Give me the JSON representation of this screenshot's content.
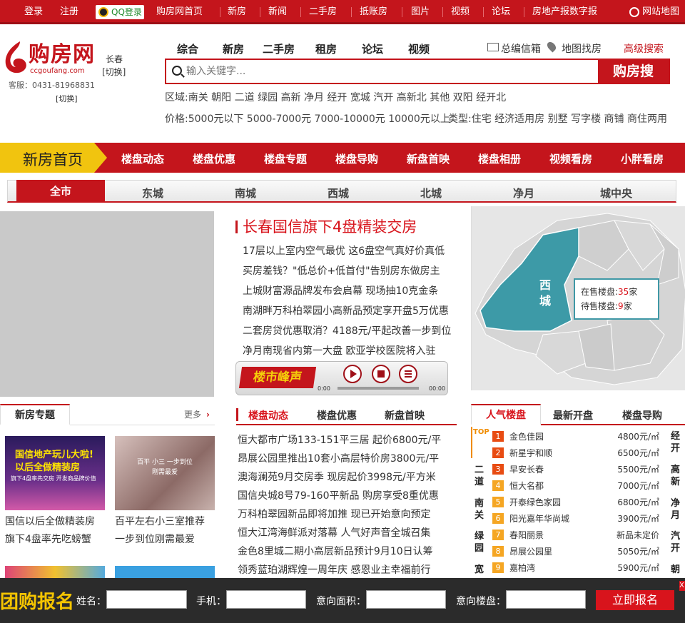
{
  "topbar": {
    "login": "登录",
    "register": "注册",
    "qq_login": "QQ登录",
    "links": [
      "购房网首页",
      "新房",
      "新闻",
      "二手房",
      "抵账房",
      "图片",
      "视频",
      "论坛",
      "房地产报数字报"
    ],
    "sitemap": "网站地图"
  },
  "header": {
    "logo_text": "购房网",
    "logo_domain": "ccgoufang.com",
    "city": "长春",
    "city_switch": "[切换]",
    "hotline": "客服：0431-81968831",
    "switch2": "[切换]",
    "search_tabs": [
      "综合",
      "新房",
      "二手房",
      "租房",
      "论坛",
      "视频"
    ],
    "mailbox": "总编信箱",
    "map_search": "地图找房",
    "advanced_search": "高级搜索",
    "search_placeholder": "输入关键字...",
    "search_button": "购房搜",
    "area_filter": "区域:南关 朝阳 二道 绿园 高新 净月 经开 宽城 汽开 高新北 其他 双阳 经开北",
    "price_filter": "价格:5000元以下 5000-7000元 7000-10000元 10000元以上",
    "type_filter": "类型:住宅 经济适用房 别墅 写字楼 商铺 商住两用"
  },
  "section_nav": {
    "home": "新房首页",
    "items": [
      "楼盘动态",
      "楼盘优惠",
      "楼盘专题",
      "楼盘导购",
      "新盘首映",
      "楼盘相册",
      "视频看房",
      "小胖看房"
    ]
  },
  "districts": [
    "全市",
    "东城",
    "南城",
    "西城",
    "北城",
    "净月",
    "城中央"
  ],
  "headline": {
    "title": "长春国信旗下4盘精装交房",
    "items": [
      "17层以上室内空气最优 这6盘空气真好价真低",
      "买房差钱？\"低总价+低首付\"告别房东做房主",
      "上城财富源品牌发布会启幕 现场抽10克金条",
      "南湖畔万科柏翠园小高新品预定享开盘5万优惠",
      "二套房贷优惠取消？4188元/平起改善一步到位",
      "净月南现省内第一大盘 欧亚学校医院将入驻"
    ]
  },
  "player": {
    "brand": "楼市峰声",
    "time_start": "0:00",
    "time_end": "00:00"
  },
  "map": {
    "area": "西城",
    "on_sale_label": "在售楼盘:",
    "on_sale_count": "35",
    "on_sale_unit": "家",
    "pending_label": "待售楼盘:",
    "pending_count": "9",
    "pending_unit": "家",
    "base_color": "#e6e6e6",
    "highlight_color": "#3d9aa7"
  },
  "zhuanti": {
    "title": "新房专题",
    "more": "更多",
    "thumb1_line1": "国信地产玩儿大啦!",
    "thumb1_line2": "以后全做精装房",
    "thumb1_small": "旗下4盘率先交房 开发商品牌价值",
    "thumb2_text": "百平 小三 一步到位 刚需最爱",
    "captions": [
      "国信以后全做精装房",
      "旗下4盘率先吃螃蟹",
      "百平左右小三室推荐",
      "一步到位刚需最爱"
    ]
  },
  "dynamics": {
    "tabs": [
      "楼盘动态",
      "楼盘优惠",
      "新盘首映"
    ],
    "items": [
      "恒大都市广场133-151平三居 起价6800元/平",
      "昂展公园里推出10套小高层特价房3800元/平",
      "澳海澜苑9月交房季 现房起价3998元/平方米",
      "国信央城8号79-160平新品 购房享受8重优惠",
      "万科柏翠园新品即将加推 现已开始意向预定",
      "恒大江湾海鲜派对落幕 人气好声音全城召集",
      "金色8里城二期小高层新品预计9月10日认筹",
      "领秀蓝珀湖辉煌一周年庆 感恩业主幸福前行"
    ]
  },
  "hot": {
    "tabs": [
      "人气楼盘",
      "最新开盘",
      "楼盘导购"
    ],
    "top_label": "TOP",
    "left_labels": [
      "二道",
      "南关",
      "绿园",
      "宽"
    ],
    "right_labels": [
      "经开",
      "高新",
      "净月",
      "汽开",
      "朝"
    ],
    "list": [
      {
        "rank": "1",
        "name": "金色佳园",
        "price": "4800元/㎡"
      },
      {
        "rank": "2",
        "name": "新星宇和顺",
        "price": "6500元/㎡"
      },
      {
        "rank": "3",
        "name": "早安长春",
        "price": "5500元/㎡"
      },
      {
        "rank": "4",
        "name": "恒大名都",
        "price": "7000元/㎡"
      },
      {
        "rank": "5",
        "name": "开泰绿色家园",
        "price": "6800元/㎡"
      },
      {
        "rank": "6",
        "name": "阳光嘉年华尚城",
        "price": "3900元/㎡"
      },
      {
        "rank": "7",
        "name": "春阳丽景",
        "price": "新品未定价"
      },
      {
        "rank": "8",
        "name": "昂展公园里",
        "price": "5050元/㎡"
      },
      {
        "rank": "9",
        "name": "嘉柏湾",
        "price": "5900元/㎡"
      }
    ]
  },
  "groupbuy": {
    "title": "团购报名",
    "name_label": "姓名：",
    "phone_label": "手机：",
    "area_label": "意向面积：",
    "project_label": "意向楼盘：",
    "submit": "立即报名",
    "close": "X"
  }
}
